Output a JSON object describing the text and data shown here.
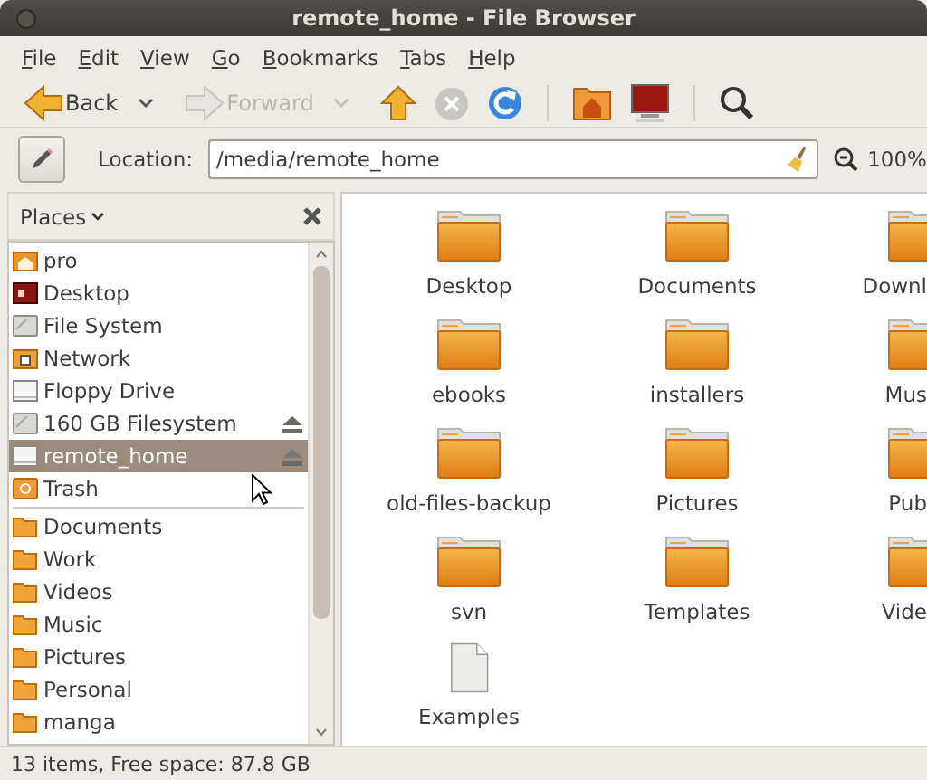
{
  "window": {
    "title": "remote_home - File Browser"
  },
  "menu": [
    "File",
    "Edit",
    "View",
    "Go",
    "Bookmarks",
    "Tabs",
    "Help"
  ],
  "toolbar": [
    {
      "kind": "back",
      "label": "Back",
      "disabled": false
    },
    {
      "kind": "forward",
      "label": "Forward",
      "disabled": true
    },
    {
      "kind": "up"
    },
    {
      "kind": "stop",
      "disabled": true
    },
    {
      "kind": "reload"
    },
    {
      "kind": "separator"
    },
    {
      "kind": "home"
    },
    {
      "kind": "computer"
    },
    {
      "kind": "separator"
    },
    {
      "kind": "search"
    }
  ],
  "location": {
    "label": "Location:",
    "value": "/media/remote_home",
    "zoom": "100%"
  },
  "sidebar": {
    "title": "Places",
    "places": [
      {
        "label": "pro",
        "kind": "home",
        "eject": false,
        "selected": false
      },
      {
        "label": "Desktop",
        "kind": "desktop",
        "eject": false,
        "selected": false
      },
      {
        "label": "File System",
        "kind": "drive",
        "eject": false,
        "selected": false
      },
      {
        "label": "Network",
        "kind": "network",
        "eject": false,
        "selected": false
      },
      {
        "label": "Floppy Drive",
        "kind": "floppy",
        "eject": false,
        "selected": false
      },
      {
        "label": "160 GB Filesystem",
        "kind": "drive",
        "eject": true,
        "selected": false
      },
      {
        "label": "remote_home",
        "kind": "floppy",
        "eject": true,
        "selected": true
      },
      {
        "label": "Trash",
        "kind": "trash",
        "eject": false,
        "selected": false
      }
    ],
    "bookmarks": [
      "Documents",
      "Work",
      "Videos",
      "Music",
      "Pictures",
      "Personal",
      "manga"
    ]
  },
  "files": [
    {
      "name": "Desktop",
      "kind": "folder"
    },
    {
      "name": "Documents",
      "kind": "folder"
    },
    {
      "name": "Downl",
      "kind": "folder-cut"
    },
    {
      "name": "ebooks",
      "kind": "folder"
    },
    {
      "name": "installers",
      "kind": "folder"
    },
    {
      "name": "Mus",
      "kind": "folder-cut"
    },
    {
      "name": "old-files-backup",
      "kind": "folder"
    },
    {
      "name": "Pictures",
      "kind": "folder"
    },
    {
      "name": "Pub",
      "kind": "folder-cut"
    },
    {
      "name": "svn",
      "kind": "folder"
    },
    {
      "name": "Templates",
      "kind": "folder"
    },
    {
      "name": "Vide",
      "kind": "folder-cut"
    },
    {
      "name": "Examples",
      "kind": "document"
    }
  ],
  "status_bar": "13 items, Free space: 87.8 GB"
}
